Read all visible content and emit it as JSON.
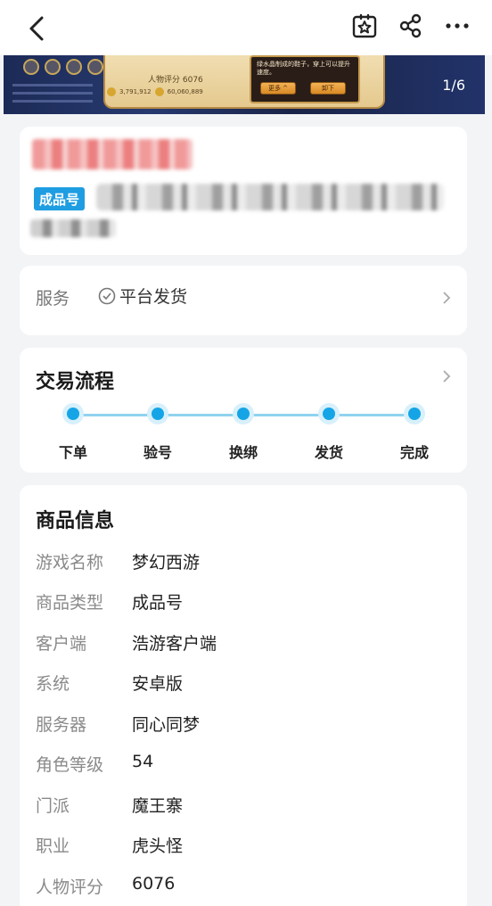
{
  "banner": {
    "counter": "1/6",
    "rating_text": "人物评分 6076",
    "popup_text": "绿水晶制成的鞋子，穿上可以提升速度。",
    "popup_more": "更多 ^",
    "popup_unload": "卸下",
    "coins": [
      "3,791,912",
      "60,060,889"
    ]
  },
  "product": {
    "badge": "成品号"
  },
  "service": {
    "label": "服务",
    "value": "平台发货"
  },
  "process": {
    "title": "交易流程",
    "steps": [
      "下单",
      "验号",
      "换绑",
      "发货",
      "完成"
    ]
  },
  "info": {
    "title": "商品信息",
    "rows": [
      {
        "key": "游戏名称",
        "value": "梦幻西游"
      },
      {
        "key": "商品类型",
        "value": "成品号"
      },
      {
        "key": "客户端",
        "value": "浩游客户端"
      },
      {
        "key": "系统",
        "value": "安卓版"
      },
      {
        "key": "服务器",
        "value": "同心同梦"
      },
      {
        "key": "角色等级",
        "value": "54"
      },
      {
        "key": "门派",
        "value": "魔王寨"
      },
      {
        "key": "职业",
        "value": "虎头怪"
      },
      {
        "key": "人物评分",
        "value": "6076"
      }
    ]
  },
  "colors": {
    "accent": "#15a5e6",
    "badge": "#1f9de2"
  },
  "icons": {
    "back": "chevron-left-icon",
    "favorite": "star-box-icon",
    "share": "share-icon",
    "more": "more-dots-icon"
  }
}
